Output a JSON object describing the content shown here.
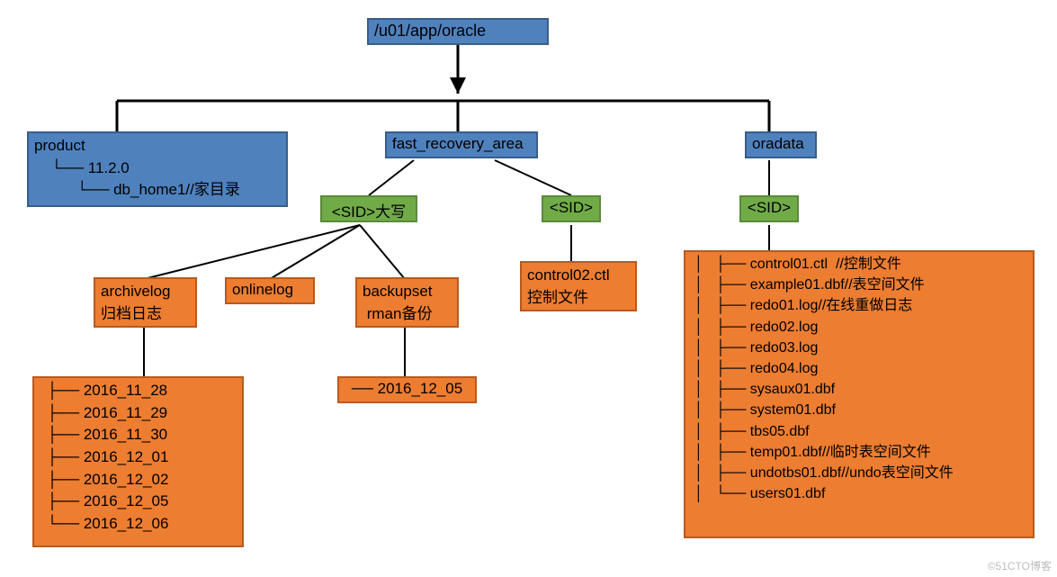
{
  "root": {
    "label": "/u01/app/oracle"
  },
  "product": {
    "title": "product",
    "tree": "    └── 11.2.0\n          └── db_home1//家目录"
  },
  "fast_recovery_area": {
    "label": "fast_recovery_area"
  },
  "oradata": {
    "label": "oradata"
  },
  "sid_fra_1": {
    "label": "<SID>大写"
  },
  "sid_fra_2": {
    "label": "<SID>"
  },
  "sid_oradata": {
    "label": "<SID>"
  },
  "archivelog": {
    "title": "archivelog",
    "subtitle": "归档日志"
  },
  "onlinelog": {
    "title": "onlinelog"
  },
  "backupset": {
    "title": "backupset",
    "subtitle": " rman备份"
  },
  "control02": {
    "title": "control02.ctl",
    "subtitle": "控制文件"
  },
  "archivelog_dates": "├── 2016_11_28\n├── 2016_11_29\n├── 2016_11_30\n├── 2016_12_01\n├── 2016_12_02\n├── 2016_12_05\n└── 2016_12_06",
  "backupset_entry": "── 2016_12_05",
  "oradata_files": "│   ├── control01.ctl  //控制文件\n│   ├── example01.dbf//表空间文件\n│   ├── redo01.log//在线重做日志\n│   ├── redo02.log\n│   ├── redo03.log\n│   ├── redo04.log\n│   ├── sysaux01.dbf\n│   ├── system01.dbf\n│   ├── tbs05.dbf\n│   ├── temp01.dbf//临时表空间文件\n│   ├── undotbs01.dbf//undo表空间文件\n│   └── users01.dbf",
  "watermark": "©51CTO博客"
}
